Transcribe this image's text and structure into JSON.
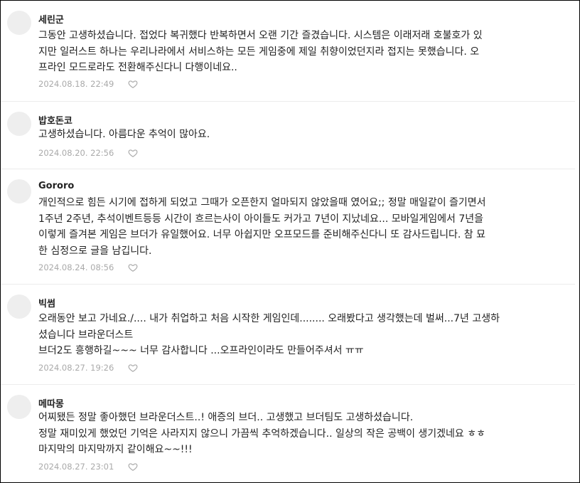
{
  "comments": [
    {
      "nickname": "세린군",
      "text": "그동안 고생하셨습니다. 접었다 복귀했다 반복하면서 오랜 기간 즐겼습니다. 시스템은 이래저래 호불호가 있\n지만 일러스트 하나는 우리나라에서 서비스하는 모든 게임중에 제일 취향이었던지라 접지는 못했습니다. 오\n프라인 모드로라도 전환해주신다니 다행이네요..",
      "date": "2024.08.18. 22:49"
    },
    {
      "nickname": "밥호돈코",
      "text": "고생하셨습니다. 아름다운 추억이 많아요.",
      "date": "2024.08.20. 22:56"
    },
    {
      "nickname": "Gororo",
      "text": "개인적으로 힘든 시기에 접하게 되었고 그때가 오픈한지 얼마되지 않았을때 였어요;; 정말 매일같이 즐기면서\n1주년 2주년, 추석이벤트등등 시간이 흐르는사이 아이들도 커가고 7년이 지났네요... 모바일게임에서 7년을\n이렇게 즐겨본 게임은 브더가 유일했어요. 너무 아쉽지만 오프모드를 준비해주신다니 또 감사드립니다. 참 묘\n한 심정으로 글을 남깁니다.",
      "date": "2024.08.24. 08:56"
    },
    {
      "nickname": "빅썸",
      "text": "오래동안 보고 가네요./.... 내가 취업하고 처음 시작한 게임인데........ 오래봤다고 생각했는데 벌써...7년 고생하\n셨습니다 브라운더스트\n브더2도 흥행하길~~~ 너무 감사합니다 ...오프라인이라도 만들어주셔서 ㅠㅠ",
      "date": "2024.08.27. 19:26"
    },
    {
      "nickname": "메따몽",
      "text": "어찌됐든 정말 좋아했던 브라운더스트..! 애증의 브더.. 고생했고 브더팀도 고생하셨습니다.\n정말 재미있게 했었던 기억은 사라지지 않으니 가끔씩 추억하겠습니다.. 일상의 작은 공백이 생기겠네요 ㅎㅎ\n마지막의 마지막까지 같이해요~~!!!",
      "date": "2024.08.27. 23:01"
    }
  ],
  "icons": {
    "like": "heart-outline-icon",
    "avatar": "default-avatar"
  },
  "colors": {
    "meta": "#aaaaaa",
    "avatar": "#eeeeee",
    "divider": "#ececec"
  }
}
